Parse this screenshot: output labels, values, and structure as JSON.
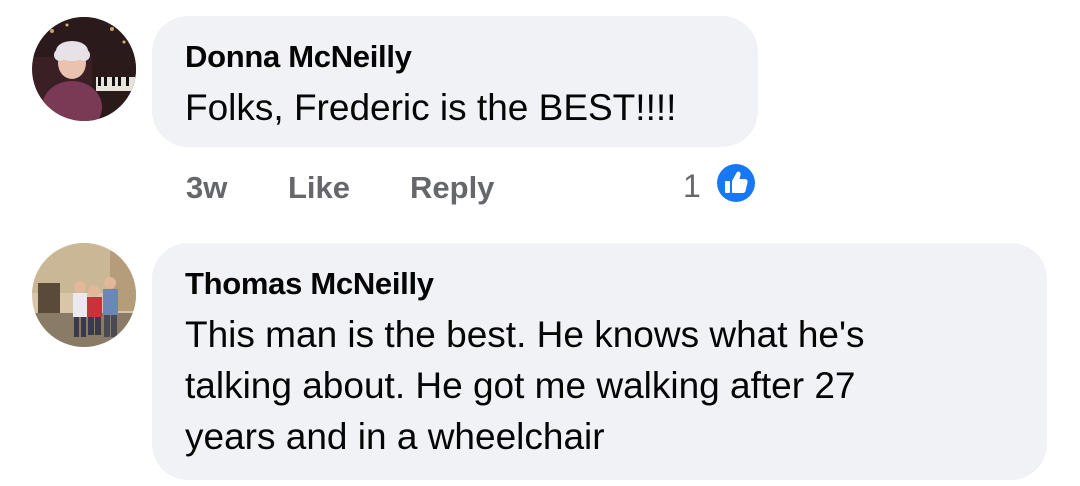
{
  "comments": [
    {
      "author": "Donna McNeilly",
      "text": "Folks, Frederic is the BEST!!!!",
      "timestamp": "3w",
      "like_label": "Like",
      "reply_label": "Reply",
      "reaction_count": "1",
      "reaction_icon": "thumbs-up-icon"
    },
    {
      "author": "Thomas McNeilly",
      "text": "This man is the best. He knows what he's\ntalking about. He got me walking after 27\nyears and in a wheelchair"
    }
  ],
  "colors": {
    "bubble_bg": "#f0f2f5",
    "secondary_text": "#65676b",
    "like_blue": "#1877f2"
  }
}
